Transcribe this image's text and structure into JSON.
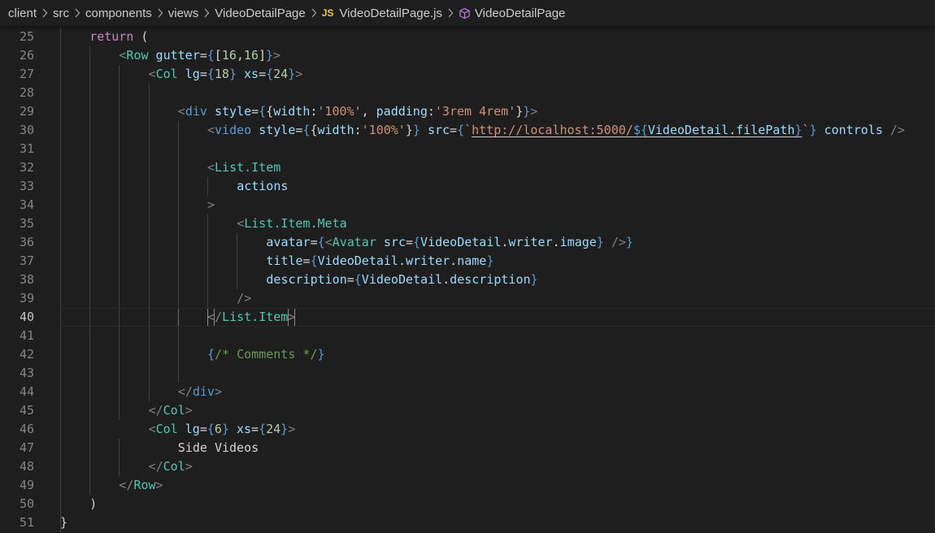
{
  "breadcrumb": {
    "items": [
      "client",
      "src",
      "components",
      "views",
      "VideoDetailPage",
      "VideoDetailPage.js",
      "VideoDetailPage"
    ],
    "js_badge": "JS"
  },
  "colors": {
    "background": "#1e1e1e",
    "keyword": "#c586c0",
    "tag": "#569cd6",
    "attribute": "#9cdcfe",
    "string": "#ce9178",
    "number": "#b5cea8",
    "component": "#4ec9b0",
    "comment": "#6a9955",
    "text": "#d4d4d4",
    "bracket": "#808080",
    "brace": "#569cd6"
  },
  "editor": {
    "active_line": "40",
    "lines": [
      {
        "n": "25",
        "tokens": [
          {
            "t": "return",
            "c": "keyword"
          },
          {
            "t": " (",
            "c": "text"
          }
        ]
      },
      {
        "n": "26",
        "tokens": [
          {
            "t": "<",
            "c": "bracket"
          },
          {
            "t": "Row",
            "c": "component"
          },
          {
            "t": " ",
            "c": "text"
          },
          {
            "t": "gutter",
            "c": "attribute"
          },
          {
            "t": "=",
            "c": "text"
          },
          {
            "t": "{",
            "c": "brace"
          },
          {
            "t": "[",
            "c": "text"
          },
          {
            "t": "16",
            "c": "number"
          },
          {
            "t": ",",
            "c": "text"
          },
          {
            "t": "16",
            "c": "number"
          },
          {
            "t": "]",
            "c": "text"
          },
          {
            "t": "}",
            "c": "brace"
          },
          {
            "t": ">",
            "c": "bracket"
          }
        ]
      },
      {
        "n": "27",
        "tokens": [
          {
            "t": "<",
            "c": "bracket"
          },
          {
            "t": "Col",
            "c": "component"
          },
          {
            "t": " ",
            "c": "text"
          },
          {
            "t": "lg",
            "c": "attribute"
          },
          {
            "t": "=",
            "c": "text"
          },
          {
            "t": "{",
            "c": "brace"
          },
          {
            "t": "18",
            "c": "number"
          },
          {
            "t": "}",
            "c": "brace"
          },
          {
            "t": " ",
            "c": "text"
          },
          {
            "t": "xs",
            "c": "attribute"
          },
          {
            "t": "=",
            "c": "text"
          },
          {
            "t": "{",
            "c": "brace"
          },
          {
            "t": "24",
            "c": "number"
          },
          {
            "t": "}",
            "c": "brace"
          },
          {
            "t": ">",
            "c": "bracket"
          }
        ]
      },
      {
        "n": "28",
        "tokens": []
      },
      {
        "n": "29",
        "tokens": [
          {
            "t": "<",
            "c": "bracket"
          },
          {
            "t": "div",
            "c": "tag"
          },
          {
            "t": " ",
            "c": "text"
          },
          {
            "t": "style",
            "c": "attribute"
          },
          {
            "t": "=",
            "c": "text"
          },
          {
            "t": "{",
            "c": "brace"
          },
          {
            "t": "{",
            "c": "text"
          },
          {
            "t": "width",
            "c": "attribute"
          },
          {
            "t": ":",
            "c": "text"
          },
          {
            "t": "'100%'",
            "c": "string"
          },
          {
            "t": ", ",
            "c": "text"
          },
          {
            "t": "padding",
            "c": "attribute"
          },
          {
            "t": ":",
            "c": "text"
          },
          {
            "t": "'3rem 4rem'",
            "c": "string"
          },
          {
            "t": "}",
            "c": "text"
          },
          {
            "t": "}",
            "c": "brace"
          },
          {
            "t": ">",
            "c": "bracket"
          }
        ]
      },
      {
        "n": "30",
        "tokens": [
          {
            "t": "<",
            "c": "bracket"
          },
          {
            "t": "video",
            "c": "tag"
          },
          {
            "t": " ",
            "c": "text"
          },
          {
            "t": "style",
            "c": "attribute"
          },
          {
            "t": "=",
            "c": "text"
          },
          {
            "t": "{",
            "c": "brace"
          },
          {
            "t": "{",
            "c": "text"
          },
          {
            "t": "width",
            "c": "attribute"
          },
          {
            "t": ":",
            "c": "text"
          },
          {
            "t": "'100%'",
            "c": "string"
          },
          {
            "t": "}",
            "c": "text"
          },
          {
            "t": "}",
            "c": "brace"
          },
          {
            "t": " ",
            "c": "text"
          },
          {
            "t": "src",
            "c": "attribute"
          },
          {
            "t": "=",
            "c": "text"
          },
          {
            "t": "{",
            "c": "brace"
          },
          {
            "t": "`",
            "c": "string"
          },
          {
            "t": "http://localhost:5000/",
            "c": "string",
            "u": true
          },
          {
            "t": "${",
            "c": "brace",
            "u": true
          },
          {
            "t": "VideoDetail",
            "c": "attribute",
            "u": true
          },
          {
            "t": ".",
            "c": "text",
            "u": true
          },
          {
            "t": "filePath",
            "c": "attribute",
            "u": true
          },
          {
            "t": "}",
            "c": "brace",
            "u": true
          },
          {
            "t": "`",
            "c": "string"
          },
          {
            "t": "}",
            "c": "brace"
          },
          {
            "t": " ",
            "c": "text"
          },
          {
            "t": "controls",
            "c": "attribute"
          },
          {
            "t": " ",
            "c": "text"
          },
          {
            "t": "/>",
            "c": "bracket"
          }
        ]
      },
      {
        "n": "31",
        "tokens": []
      },
      {
        "n": "32",
        "tokens": [
          {
            "t": "<",
            "c": "bracket"
          },
          {
            "t": "List.Item",
            "c": "component"
          }
        ]
      },
      {
        "n": "33",
        "tokens": [
          {
            "t": "actions",
            "c": "attribute"
          }
        ]
      },
      {
        "n": "34",
        "tokens": [
          {
            "t": ">",
            "c": "bracket"
          }
        ]
      },
      {
        "n": "35",
        "tokens": [
          {
            "t": "<",
            "c": "bracket"
          },
          {
            "t": "List.Item.Meta",
            "c": "component"
          }
        ]
      },
      {
        "n": "36",
        "tokens": [
          {
            "t": "avatar",
            "c": "attribute"
          },
          {
            "t": "=",
            "c": "text"
          },
          {
            "t": "{",
            "c": "brace"
          },
          {
            "t": "<",
            "c": "bracket"
          },
          {
            "t": "Avatar",
            "c": "component"
          },
          {
            "t": " ",
            "c": "text"
          },
          {
            "t": "src",
            "c": "attribute"
          },
          {
            "t": "=",
            "c": "text"
          },
          {
            "t": "{",
            "c": "brace"
          },
          {
            "t": "VideoDetail",
            "c": "attribute"
          },
          {
            "t": ".",
            "c": "text"
          },
          {
            "t": "writer",
            "c": "attribute"
          },
          {
            "t": ".",
            "c": "text"
          },
          {
            "t": "image",
            "c": "attribute"
          },
          {
            "t": "}",
            "c": "brace"
          },
          {
            "t": " ",
            "c": "text"
          },
          {
            "t": "/>",
            "c": "bracket"
          },
          {
            "t": "}",
            "c": "brace"
          }
        ]
      },
      {
        "n": "37",
        "tokens": [
          {
            "t": "title",
            "c": "attribute"
          },
          {
            "t": "=",
            "c": "text"
          },
          {
            "t": "{",
            "c": "brace"
          },
          {
            "t": "VideoDetail",
            "c": "attribute"
          },
          {
            "t": ".",
            "c": "text"
          },
          {
            "t": "writer",
            "c": "attribute"
          },
          {
            "t": ".",
            "c": "text"
          },
          {
            "t": "name",
            "c": "attribute"
          },
          {
            "t": "}",
            "c": "brace"
          }
        ]
      },
      {
        "n": "38",
        "tokens": [
          {
            "t": "description",
            "c": "attribute"
          },
          {
            "t": "=",
            "c": "text"
          },
          {
            "t": "{",
            "c": "brace"
          },
          {
            "t": "VideoDetail",
            "c": "attribute"
          },
          {
            "t": ".",
            "c": "text"
          },
          {
            "t": "description",
            "c": "attribute"
          },
          {
            "t": "}",
            "c": "brace"
          }
        ]
      },
      {
        "n": "39",
        "tokens": [
          {
            "t": "/>",
            "c": "bracket"
          }
        ]
      },
      {
        "n": "40",
        "tokens": [
          {
            "t": "<",
            "c": "bracket",
            "box": true
          },
          {
            "t": "/",
            "c": "bracket"
          },
          {
            "t": "List.Item",
            "c": "component"
          },
          {
            "t": ">",
            "c": "bracket",
            "box": true
          }
        ]
      },
      {
        "n": "41",
        "tokens": []
      },
      {
        "n": "42",
        "tokens": [
          {
            "t": "{",
            "c": "brace"
          },
          {
            "t": "/* Comments */",
            "c": "comment"
          },
          {
            "t": "}",
            "c": "brace"
          }
        ]
      },
      {
        "n": "43",
        "tokens": []
      },
      {
        "n": "44",
        "tokens": [
          {
            "t": "</",
            "c": "bracket"
          },
          {
            "t": "div",
            "c": "tag"
          },
          {
            "t": ">",
            "c": "bracket"
          }
        ]
      },
      {
        "n": "45",
        "tokens": [
          {
            "t": "</",
            "c": "bracket"
          },
          {
            "t": "Col",
            "c": "component"
          },
          {
            "t": ">",
            "c": "bracket"
          }
        ]
      },
      {
        "n": "46",
        "tokens": [
          {
            "t": "<",
            "c": "bracket"
          },
          {
            "t": "Col",
            "c": "component"
          },
          {
            "t": " ",
            "c": "text"
          },
          {
            "t": "lg",
            "c": "attribute"
          },
          {
            "t": "=",
            "c": "text"
          },
          {
            "t": "{",
            "c": "brace"
          },
          {
            "t": "6",
            "c": "number"
          },
          {
            "t": "}",
            "c": "brace"
          },
          {
            "t": " ",
            "c": "text"
          },
          {
            "t": "xs",
            "c": "attribute"
          },
          {
            "t": "=",
            "c": "text"
          },
          {
            "t": "{",
            "c": "brace"
          },
          {
            "t": "24",
            "c": "number"
          },
          {
            "t": "}",
            "c": "brace"
          },
          {
            "t": ">",
            "c": "bracket"
          }
        ]
      },
      {
        "n": "47",
        "tokens": [
          {
            "t": "Side Videos",
            "c": "text"
          }
        ]
      },
      {
        "n": "48",
        "tokens": [
          {
            "t": "</",
            "c": "bracket"
          },
          {
            "t": "Col",
            "c": "component"
          },
          {
            "t": ">",
            "c": "bracket"
          }
        ]
      },
      {
        "n": "49",
        "tokens": [
          {
            "t": "</",
            "c": "bracket"
          },
          {
            "t": "Row",
            "c": "component"
          },
          {
            "t": ">",
            "c": "bracket"
          }
        ]
      },
      {
        "n": "50",
        "tokens": [
          {
            "t": ")",
            "c": "text"
          }
        ]
      },
      {
        "n": "51",
        "tokens": [
          {
            "t": "}",
            "c": "text"
          }
        ]
      }
    ]
  }
}
